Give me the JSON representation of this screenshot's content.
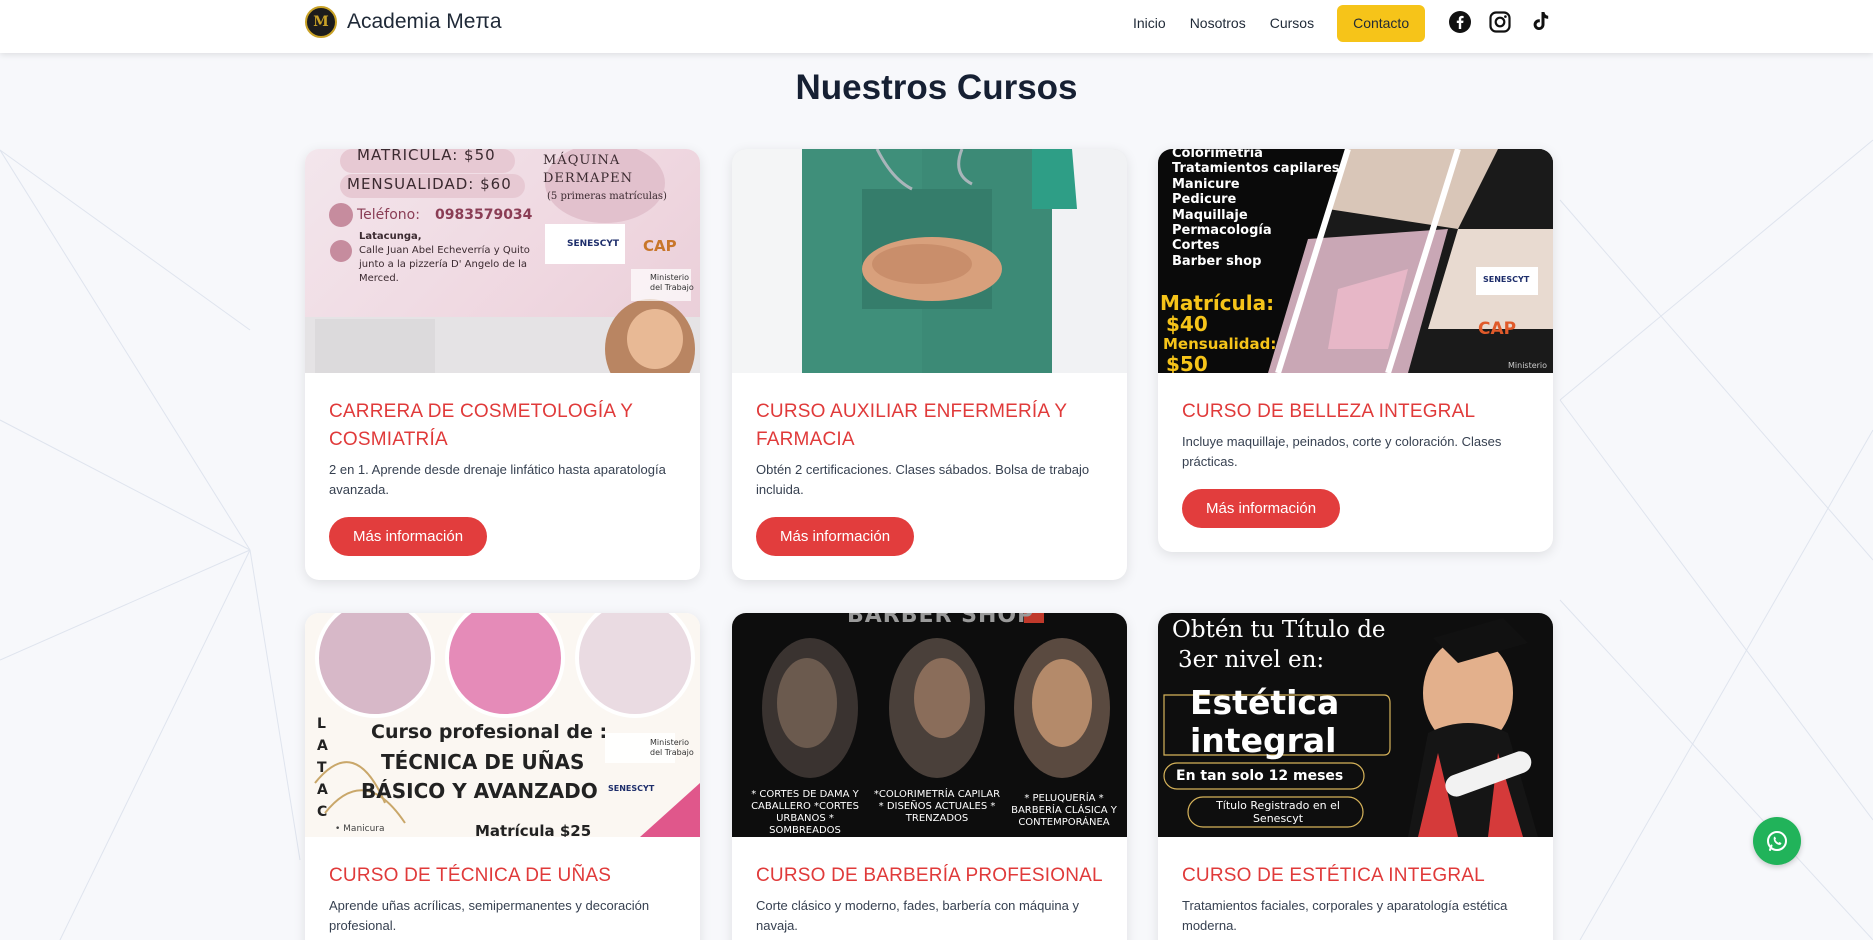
{
  "header": {
    "brand_mark": "M",
    "brand_name": "Academia Meπa",
    "nav": [
      "Inicio",
      "Nosotros",
      "Cursos"
    ],
    "contact_label": "Contacto",
    "socials": [
      "facebook-icon",
      "instagram-icon",
      "tiktok-icon"
    ]
  },
  "section": {
    "title": "Nuestros Cursos"
  },
  "courses": [
    {
      "title": "CARRERA DE COSMETOLOGÍA Y COSMIATRÍA",
      "desc": "2 en 1. Aprende desde drenaje linfático hasta aparatología avanzada.",
      "button": "Más información",
      "image_text": {
        "line1": "MATRICULA: $50",
        "line2": "MENSUALIDAD: $60",
        "line3": "MÁQUINA DERMAPEN",
        "line4": "(5 primeras matrículas)",
        "phone_label": "Teléfono:",
        "phone": "0983579034",
        "address_city": "Latacunga,",
        "address": "Calle Juan Abel Echeverría y Quito junto a la pizzería D' Angelo de la Merced.",
        "logo1": "SENESCYT",
        "logo2": "CAP",
        "logo3": "Ministerio del Trabajo"
      }
    },
    {
      "title": "CURSO AUXILIAR ENFERMERÍA Y FARMACIA",
      "desc": "Obtén 2 certificaciones. Clases sábados. Bolsa de trabajo incluida.",
      "button": "Más información"
    },
    {
      "title": "CURSO DE BELLEZA INTEGRAL",
      "desc": "Incluye maquillaje, peinados, corte y coloración. Clases prácticas.",
      "button": "Más información",
      "image_text": {
        "list": [
          "Colorimetría",
          "Tratamientos capilares",
          "Manicure",
          "Pedicure",
          "Maquillaje",
          "Permacología",
          "Cortes",
          "Barber shop"
        ],
        "price1": "Matrícula:",
        "price1_val": "$40",
        "price2": "Mensualidad:",
        "price2_val": "$50",
        "logo1": "SENESCYT",
        "logo2": "CAP",
        "logo3": "Ministerio"
      }
    },
    {
      "title": "CURSO DE TÉCNICA DE UÑAS",
      "desc": "Aprende uñas acrílicas, semipermanentes y decoración profesional.",
      "image_text": {
        "line1": "Curso profesional de :",
        "line2": "TÉCNICA DE UÑAS",
        "line3": "BÁSICO Y AVANZADO",
        "line4": "Matrícula $25",
        "side": "LATAC",
        "tag": "• Manicura",
        "logo1": "SENESCYT",
        "logo3": "Ministerio del Trabajo"
      }
    },
    {
      "title": "CURSO DE BARBERÍA PROFESIONAL",
      "desc": "Corte clásico y moderno, fades, barbería con máquina y navaja.",
      "image_text": {
        "top": "BARBER SHOP",
        "col1": "* CORTES DE DAMA Y CABALLERO *CORTES URBANOS * SOMBREADOS",
        "col2": "*COLORIMETRÍA CAPILAR * DISEÑOS ACTUALES * TRENZADOS",
        "col3": "* PELUQUERÍA * BARBERÍA CLÁSICA Y CONTEMPORÁNEA"
      }
    },
    {
      "title": "CURSO DE ESTÉTICA INTEGRAL",
      "desc": "Tratamientos faciales, corporales y aparatología estética moderna.",
      "image_text": {
        "line1": "Obtén tu Título de",
        "line2": "3er nivel en:",
        "line3": "Estética",
        "line4": "integral",
        "line5": "En tan solo 12 meses",
        "line6": "Título Registrado en el Senescyt"
      }
    }
  ],
  "colors": {
    "accent": "#e23d3d",
    "title_red": "#e03a3a",
    "contact_yellow": "#f6c419",
    "whatsapp_green": "#21b35a"
  },
  "floating": {
    "icon": "whatsapp-icon"
  }
}
